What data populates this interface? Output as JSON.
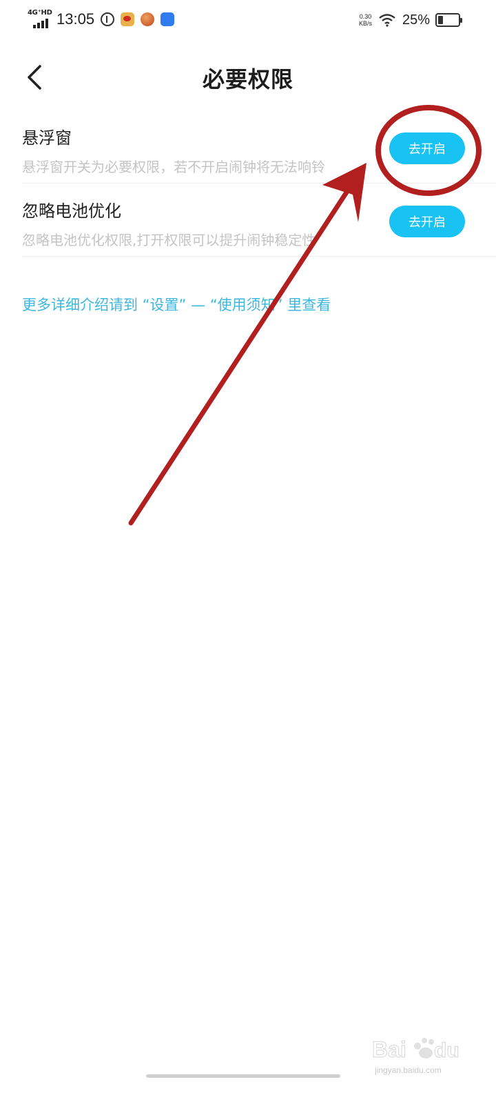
{
  "status_bar": {
    "network": "4G⁺HD",
    "time": "13:05",
    "net_speed_value": "0.30",
    "net_speed_unit": "KB/s",
    "battery_percent": "25%",
    "battery_level": 0.25
  },
  "header": {
    "back_icon": "chevron-left-icon",
    "title": "必要权限"
  },
  "permissions": [
    {
      "title": "悬浮窗",
      "description": "悬浮窗开关为必要权限，若不开启闹钟将无法响铃",
      "button_label": "去开启"
    },
    {
      "title": "忽略电池优化",
      "description": "忽略电池优化权限,打开权限可以提升闹钟稳定性",
      "button_label": "去开启"
    }
  ],
  "more_info": "更多详细介绍请到 “设置” — “使用须知” 里查看",
  "annotation": {
    "color": "#b21f1f"
  },
  "watermark": {
    "subtext": "jingyan.baidu.com"
  },
  "colors": {
    "accent": "#18c3f4",
    "link": "#3db7dd",
    "description": "#c4c4c4"
  }
}
